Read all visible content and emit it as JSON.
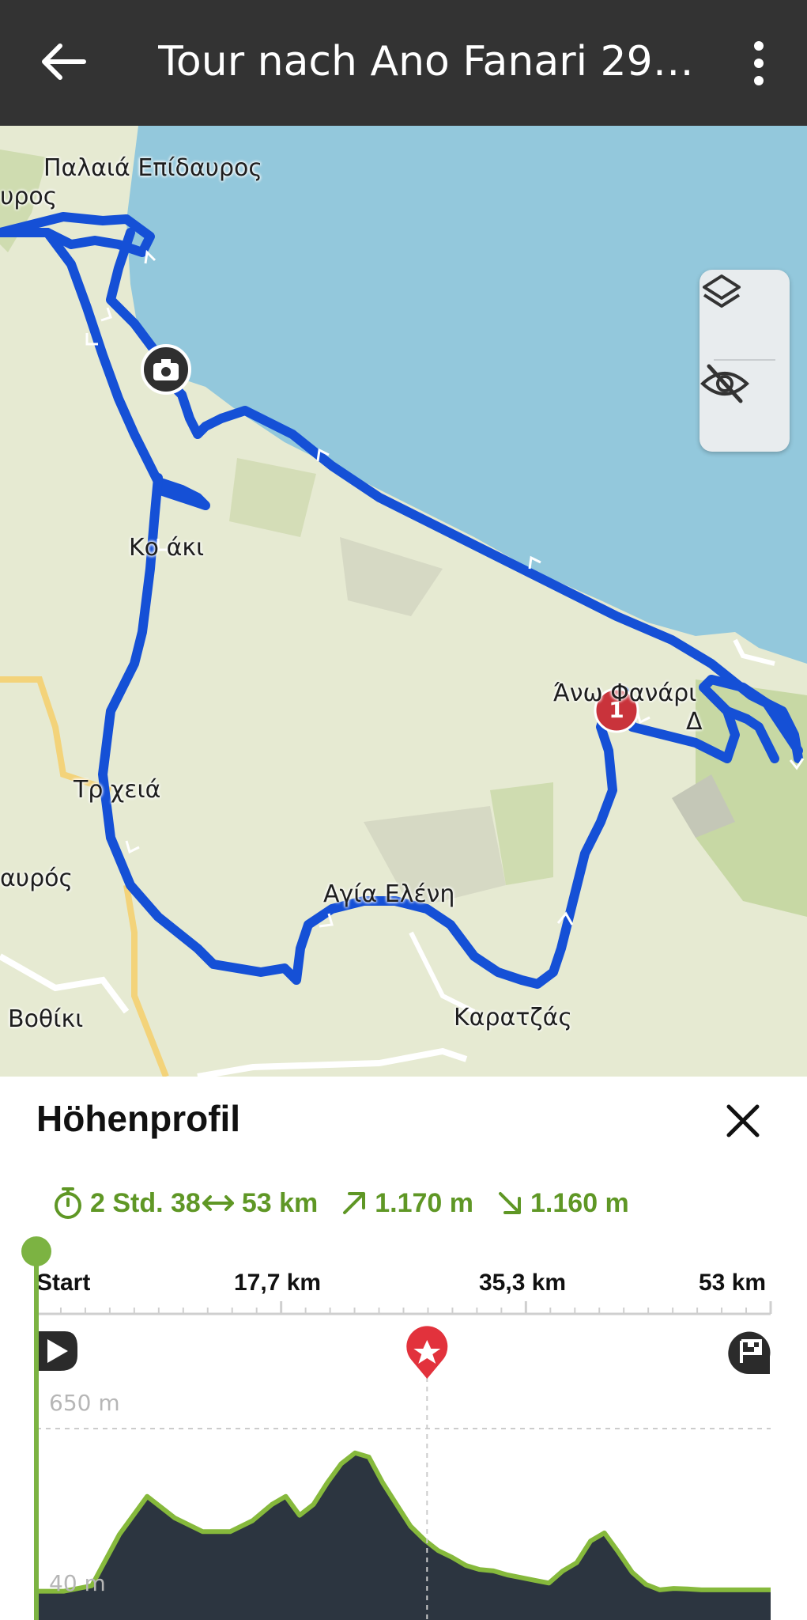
{
  "appbar": {
    "title": "Tour nach Ano Fanari 29.0…",
    "back_icon": "arrow-left-icon",
    "more_icon": "more-vertical-icon"
  },
  "map": {
    "places": [
      {
        "id": "palaia",
        "name": "Παλαιά Επίδαυρος"
      },
      {
        "id": "epidavros",
        "name": "υρος"
      },
      {
        "id": "koliaki",
        "name": "Κο  άκι"
      },
      {
        "id": "trachia",
        "name": "Τρ  χειά"
      },
      {
        "id": "avros",
        "name": "αυρός"
      },
      {
        "id": "agia",
        "name": "Αγία Ελένη"
      },
      {
        "id": "vothiki",
        "name": "Βοθίκι"
      },
      {
        "id": "karatzas",
        "name": "Καρατζάς"
      },
      {
        "id": "ano",
        "name": "Άνω Φανάρι"
      },
      {
        "id": "d",
        "name": "Δ"
      }
    ],
    "waypoint_number": "1",
    "colors": {
      "route": "#1550d6",
      "sea": "#93c8dc",
      "land": "#e6ead2",
      "marker": "#c9333b"
    },
    "controls": {
      "layers_icon": "layers-icon",
      "hide_icon": "eye-off-icon"
    },
    "photo_icon": "camera-icon"
  },
  "elevation": {
    "heading": "Höhenprofil",
    "close_icon": "close-icon",
    "stats": {
      "duration": "2 Std. 38",
      "distance": "53 km",
      "ascent": "1.170 m",
      "descent": "1.160 m"
    },
    "axis": {
      "start": "Start",
      "mid1": "17,7 km",
      "mid2": "35,3 km",
      "end": "53 km"
    },
    "max_label": "650 m",
    "min_label": "40 m",
    "accent": "#7cb342"
  },
  "chart_data": {
    "type": "area",
    "title": "Höhenprofil",
    "xlabel": "",
    "ylabel": "",
    "x_unit": "km",
    "y_unit": "m",
    "xlim": [
      0,
      53
    ],
    "ylim": [
      40,
      650
    ],
    "x_ticks": [
      "Start",
      "17,7 km",
      "35,3 km",
      "53 km"
    ],
    "x": [
      0,
      2,
      4,
      6,
      8,
      10,
      12,
      14,
      15.6,
      17,
      18,
      19,
      20,
      21,
      22,
      23,
      24,
      25,
      26,
      27,
      28,
      29,
      30,
      31,
      32,
      33,
      34,
      35,
      36,
      37,
      38,
      39,
      40,
      41,
      42,
      43,
      44,
      45,
      46,
      47,
      48,
      49,
      50,
      51,
      52,
      53
    ],
    "y": [
      50,
      50,
      70,
      260,
      400,
      320,
      270,
      270,
      310,
      370,
      400,
      330,
      370,
      450,
      520,
      560,
      545,
      450,
      370,
      290,
      240,
      200,
      175,
      145,
      130,
      125,
      110,
      100,
      90,
      80,
      125,
      155,
      235,
      265,
      195,
      120,
      75,
      55,
      60,
      58,
      55,
      55,
      55,
      55,
      55,
      55
    ],
    "markers": [
      {
        "label": "start",
        "x": 0
      },
      {
        "label": "highlight",
        "x": 28.2
      },
      {
        "label": "finish",
        "x": 53
      }
    ],
    "grid": false,
    "legend": "none"
  }
}
